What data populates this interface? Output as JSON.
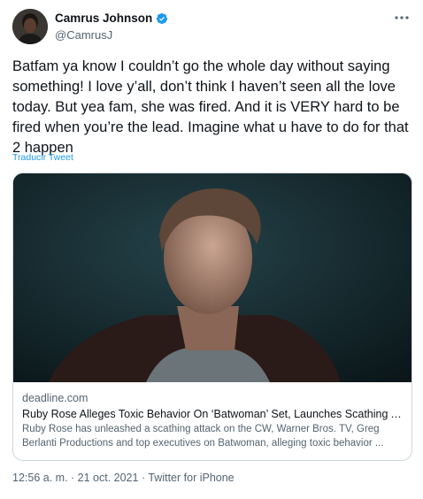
{
  "author": {
    "display_name": "Camrus Johnson",
    "handle": "@CamrusJ",
    "verified_icon": "verified-badge-icon"
  },
  "tweet": {
    "text": "Batfam ya know I couldn’t go the whole day without saying something! I love y’all, don’t think I haven’t seen all the love today. But yea fam, she was fired. And it is VERY hard to be fired when you’re the lead. Imagine what u have to do for that 2 happen",
    "translate_label": "Traducir Tweet"
  },
  "card": {
    "domain": "deadline.com",
    "title": "Ruby Rose Alleges Toxic Behavior On ‘Batwoman’ Set, Launches Scathing Atta...",
    "description": "Ruby Rose has unleashed a scathing attack on the CW, Warner Bros. TV, Greg Berlanti Productions and top executives on Batwoman, alleging toxic behavior ..."
  },
  "meta": {
    "time": "12:56 a. m.",
    "separator": " · ",
    "date": "21 oct. 2021",
    "source": "Twitter for iPhone"
  },
  "colors": {
    "accent": "#1d9bf0",
    "text_primary": "#0f1419",
    "text_secondary": "#536471",
    "border": "#cfd9de"
  }
}
